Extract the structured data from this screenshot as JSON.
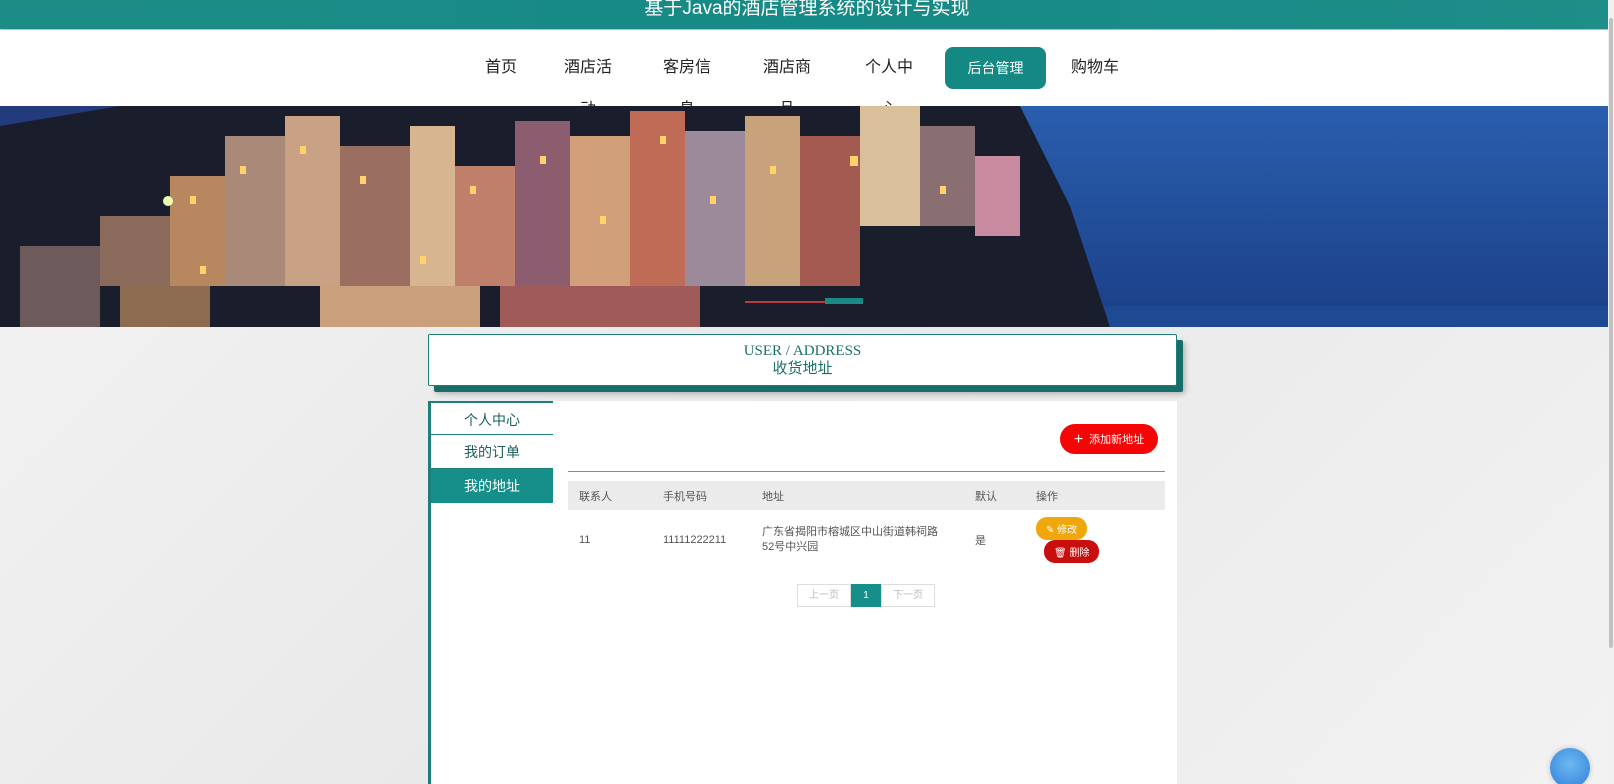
{
  "header": {
    "title": "基于Java的酒店管理系统的设计与实现"
  },
  "nav": {
    "items": [
      {
        "label": "首页"
      },
      {
        "label": "酒店活动"
      },
      {
        "label": "客房信息"
      },
      {
        "label": "酒店商品"
      },
      {
        "label": "个人中心"
      },
      {
        "label": "后台管理"
      },
      {
        "label": "购物车"
      }
    ],
    "active_index": 5,
    "accent_color": "#148883"
  },
  "section": {
    "title_en": "USER / ADDRESS",
    "title_cn": "收货地址"
  },
  "sidebar": {
    "items": [
      {
        "label": "个人中心"
      },
      {
        "label": "我的订单"
      },
      {
        "label": "我的地址"
      }
    ],
    "active_index": 2
  },
  "toolbar": {
    "add_label": "添加新地址",
    "add_icon": "plus-icon"
  },
  "table": {
    "headers": [
      "联系人",
      "手机号码",
      "地址",
      "默认",
      "操作"
    ],
    "rows": [
      {
        "contact": "11",
        "phone": "11111222211",
        "address": "广东省揭阳市榕城区中山街道韩祠路52号中兴园",
        "default": "是",
        "edit_label": "修改",
        "delete_label": "删除"
      }
    ]
  },
  "pagination": {
    "prev_label": "上一页",
    "current": "1",
    "next_label": "下一页"
  }
}
